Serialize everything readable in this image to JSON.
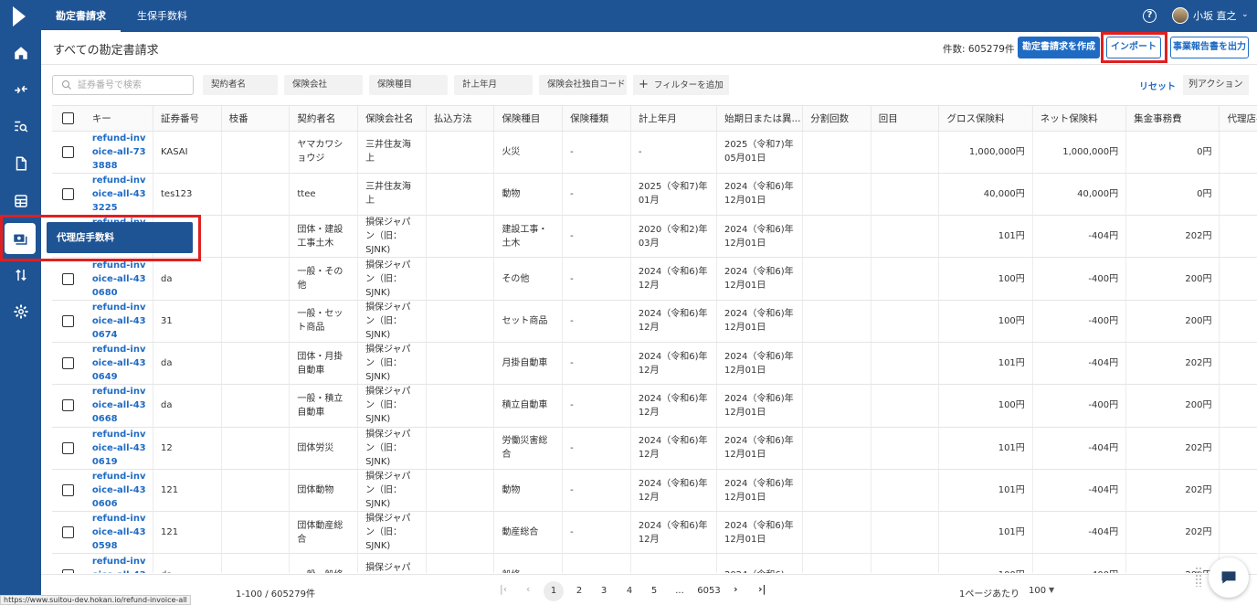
{
  "topbar": {
    "tabs": [
      {
        "label": "勘定書請求",
        "active": true
      },
      {
        "label": "生保手数料",
        "active": false
      }
    ],
    "help_label": "?",
    "user_name": "小坂 直之"
  },
  "header": {
    "title": "すべての勘定書請求",
    "count": "件数: 605279件",
    "create_label": "勘定書請求を作成",
    "import_label": "インポート",
    "report_label": "事業報告書を出力"
  },
  "filters": {
    "search_placeholder": "証券番号で検索",
    "chips": [
      "契約者名",
      "保険会社",
      "保険種目",
      "計上年月",
      "保険会社独自コード"
    ],
    "add_filter": "フィルターを追加",
    "reset": "リセット",
    "column_actions": "列アクション"
  },
  "table": {
    "columns": [
      "キー",
      "証券番号",
      "枝番",
      "契約者名",
      "保険会社名",
      "払込方法",
      "保険種目",
      "保険種類",
      "計上年月",
      "始期日または異...",
      "分割回数",
      "回目",
      "グロス保険料",
      "ネット保険料",
      "集金事務費",
      "代理店手数"
    ],
    "rows": [
      [
        "refund-invoice-all-733888",
        "KASAI",
        "",
        "ヤマカワショウジ",
        "三井住友海上",
        "",
        "火災",
        "-",
        "-",
        "2025（令和7)年05月01日",
        "",
        "",
        "1,000,000円",
        "1,000,000円",
        "0円"
      ],
      [
        "refund-invoice-all-433225",
        "tes123",
        "",
        "ttee",
        "三井住友海上",
        "",
        "動物",
        "-",
        "2025（令和7)年01月",
        "2024（令和6)年12月01日",
        "",
        "",
        "40,000円",
        "40,000円",
        "0円"
      ],
      [
        "refund-invoice-all-430687",
        "",
        "",
        "団体・建設工事土木",
        "損保ジャパン（旧：SJNK)",
        "",
        "建設工事・土木",
        "-",
        "2020（令和2)年03月",
        "2024（令和6)年12月01日",
        "",
        "",
        "101円",
        "-404円",
        "202円"
      ],
      [
        "refund-invoice-all-430680",
        "da",
        "",
        "一般・その他",
        "損保ジャパン（旧：SJNK)",
        "",
        "その他",
        "-",
        "2024（令和6)年12月",
        "2024（令和6)年12月01日",
        "",
        "",
        "100円",
        "-400円",
        "200円"
      ],
      [
        "refund-invoice-all-430674",
        "31",
        "",
        "一般・セット商品",
        "損保ジャパン（旧：SJNK)",
        "",
        "セット商品",
        "-",
        "2024（令和6)年12月",
        "2024（令和6)年12月01日",
        "",
        "",
        "100円",
        "-400円",
        "200円"
      ],
      [
        "refund-invoice-all-430649",
        "da",
        "",
        "団体・月掛自動車",
        "損保ジャパン（旧：SJNK)",
        "",
        "月掛自動車",
        "-",
        "2024（令和6)年12月",
        "2024（令和6)年12月01日",
        "",
        "",
        "101円",
        "-404円",
        "202円"
      ],
      [
        "refund-invoice-all-430668",
        "da",
        "",
        "一般・積立自動車",
        "損保ジャパン（旧：SJNK)",
        "",
        "積立自動車",
        "-",
        "2024（令和6)年12月",
        "2024（令和6)年12月01日",
        "",
        "",
        "100円",
        "-400円",
        "200円"
      ],
      [
        "refund-invoice-all-430619",
        "12",
        "",
        "団体労災",
        "損保ジャパン（旧：SJNK)",
        "",
        "労働災害総合",
        "-",
        "2024（令和6)年12月",
        "2024（令和6)年12月01日",
        "",
        "",
        "101円",
        "-404円",
        "202円"
      ],
      [
        "refund-invoice-all-430606",
        "121",
        "",
        "団体動物",
        "損保ジャパン（旧：SJNK)",
        "",
        "動物",
        "-",
        "2024（令和6)年12月",
        "2024（令和6)年12月01日",
        "",
        "",
        "101円",
        "-404円",
        "202円"
      ],
      [
        "refund-invoice-all-430598",
        "121",
        "",
        "団体動産総合",
        "損保ジャパン（旧：SJNK)",
        "",
        "動産総合",
        "-",
        "2024（令和6)年12月",
        "2024（令和6)年12月01日",
        "",
        "",
        "101円",
        "-404円",
        "202円"
      ],
      [
        "refund-invoice-all-4306",
        "da",
        "",
        "一般・船修",
        "損保ジャパン",
        "",
        "船修",
        "-",
        "",
        "2024（令和6)",
        "",
        "",
        "100円",
        "-400円",
        "200円"
      ]
    ]
  },
  "tooltip": "代理店手数料",
  "pagination": {
    "range": "1-100 / 605279件",
    "pages": [
      "1",
      "2",
      "3",
      "4",
      "5",
      "...",
      "6053"
    ],
    "per_page_label": "1ページあたり",
    "per_page_value": "100"
  },
  "status_url": "https://www.suitou-dev.hokan.io/refund-invoice-all",
  "colors": {
    "brand": "#1f5494",
    "primary": "#1f6bc4",
    "highlight": "#e02020"
  }
}
